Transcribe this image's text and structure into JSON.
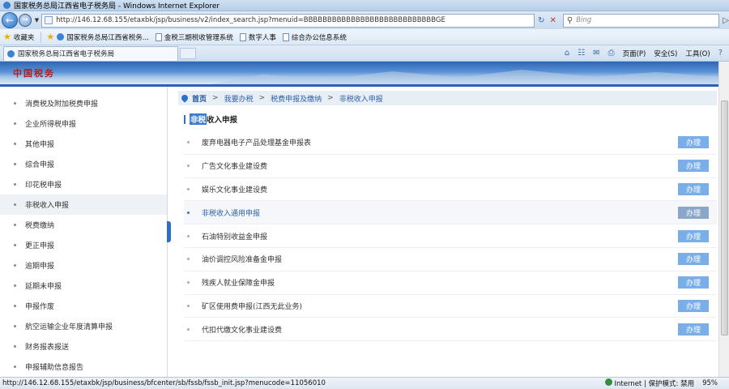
{
  "window": {
    "title": "国家税务总局江西省电子税务局 - Windows Internet Explorer"
  },
  "address": {
    "url": "http://146.12.68.155/etaxbk/jsp/business/v2/index_search.jsp?menuid=BBBBBBBBBBBBBBBBBBBBBBBBBBBBGE"
  },
  "search": {
    "placeholder": "Bing"
  },
  "favorites": {
    "label": "收藏夹",
    "items": [
      "国家税务总局江西省税务...",
      "金税三期税收管理系统",
      "数字人事",
      "综合办公信息系统"
    ]
  },
  "tab": {
    "title": "国家税务总局江西省电子税务局"
  },
  "commands": {
    "page": "页面(P)",
    "safety": "安全(S)",
    "tools": "工具(O)",
    "help": "?"
  },
  "banner": {
    "logo": "中国税务"
  },
  "sidebar": {
    "items": [
      "消费税及附加税费申报",
      "企业所得税申报",
      "其他申报",
      "综合申报",
      "印花税申报",
      "非税收入申报",
      "税费缴纳",
      "更正申报",
      "逾期申报",
      "延期未申报",
      "申报作废",
      "航空运输企业年度清算申报",
      "财务报表报送",
      "申报辅助信息报告"
    ],
    "active_index": 5
  },
  "breadcrumb": {
    "home": "首页",
    "items": [
      "我要办税",
      "税费申报及缴纳",
      "非税收入申报"
    ]
  },
  "section": {
    "title_highlight": "非税",
    "title_rest": "收入申报"
  },
  "list": {
    "button_label": "办理",
    "items": [
      "废弃电器电子产品处理基金申报表",
      "广告文化事业建设费",
      "娱乐文化事业建设费",
      "非税收入通用申报",
      "石油特别收益金申报",
      "油价调控风险准备金申报",
      "残疾人就业保障金申报",
      "矿区使用费申报(江西无此业务)",
      "代扣代缴文化事业建设费"
    ],
    "active_index": 3
  },
  "status": {
    "url": "http://146.12.68.155/etaxbk/jsp/business/bfcenter/sb/fssb/fssb_init.jsp?menucode=11056010",
    "zone": "Internet | 保护模式: 禁用",
    "zoom": "95%"
  }
}
